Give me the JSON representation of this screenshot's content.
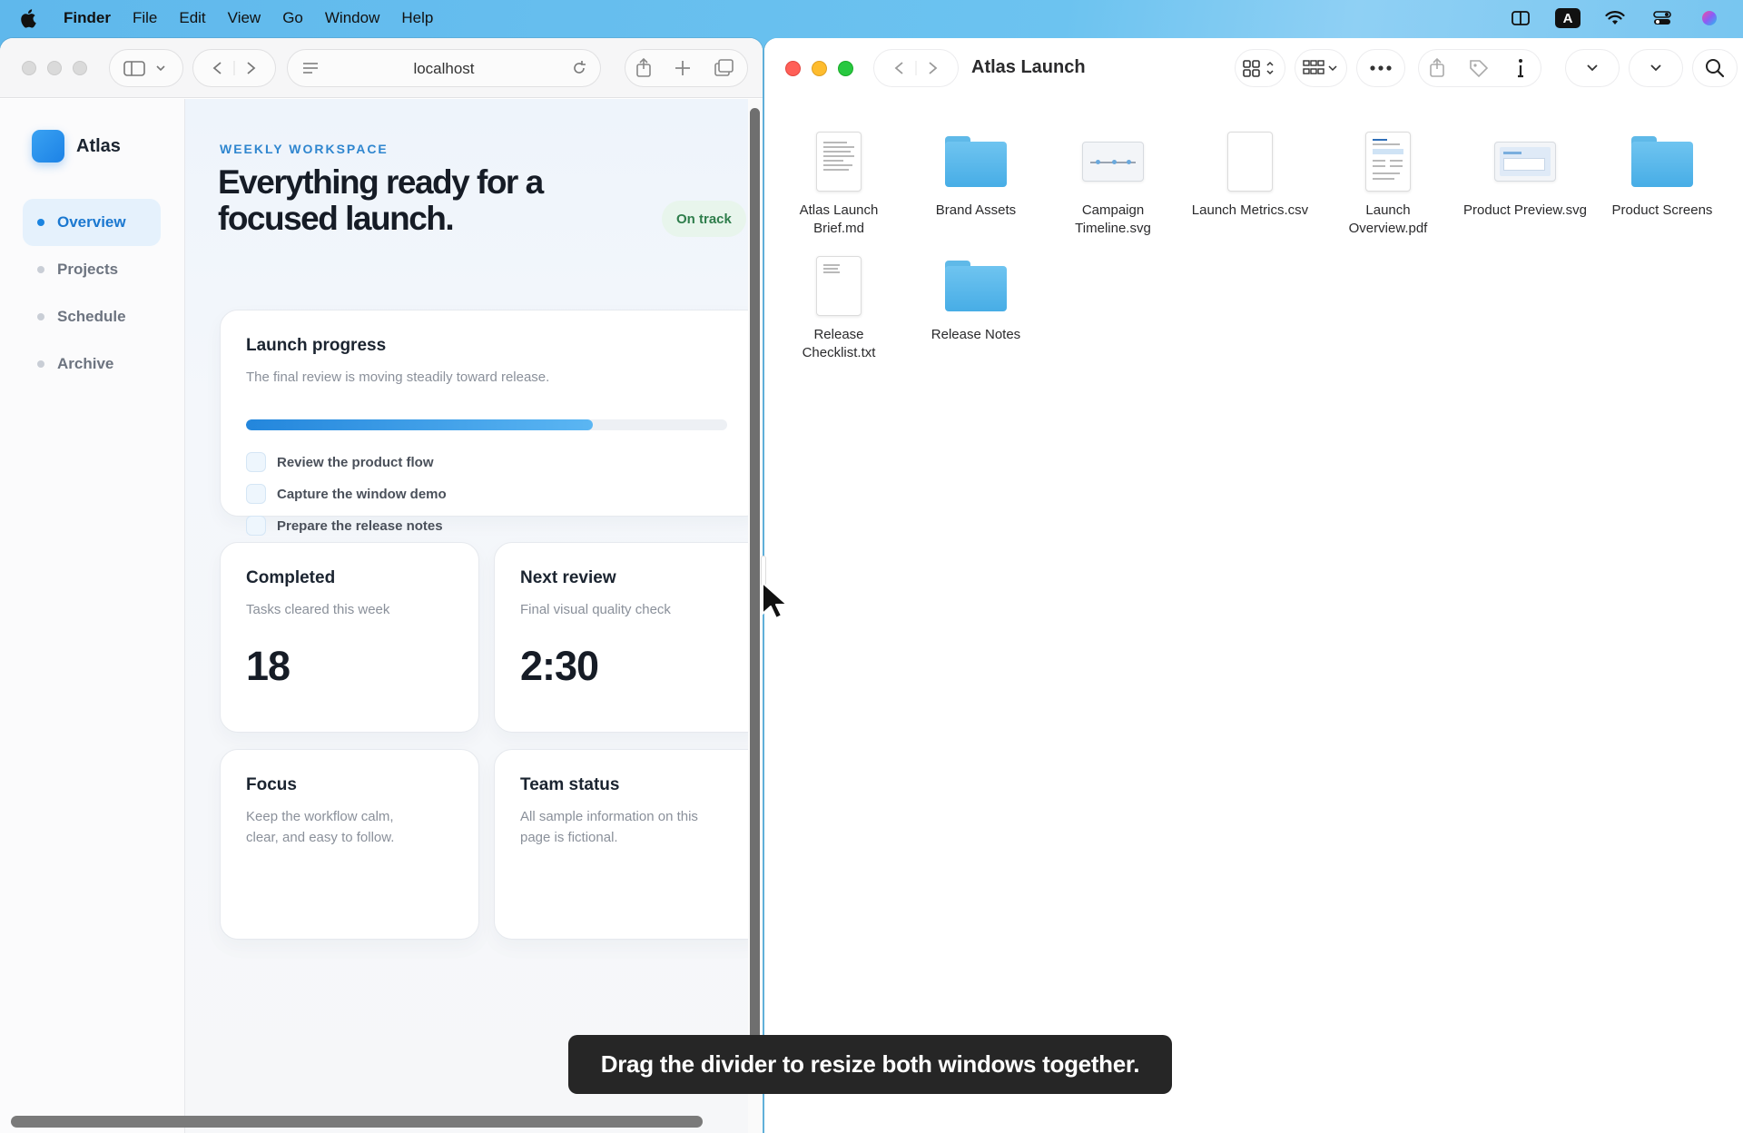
{
  "menubar": {
    "app": "Finder",
    "items": [
      "File",
      "Edit",
      "View",
      "Go",
      "Window",
      "Help"
    ],
    "input_badge": "A"
  },
  "browser": {
    "url": "localhost",
    "brand": "Atlas",
    "nav": [
      "Overview",
      "Projects",
      "Schedule",
      "Archive"
    ],
    "eyebrow": "WEEKLY WORKSPACE",
    "headline": "Everything ready for a focused launch.",
    "status_badge": "On track",
    "progress_card": {
      "title": "Launch progress",
      "subtitle": "The final review is moving steadily toward release.",
      "progress_fraction": 0.72,
      "tasks": [
        "Review the product flow",
        "Capture the window demo",
        "Prepare the release notes"
      ]
    },
    "completed_card": {
      "title": "Completed",
      "subtitle": "Tasks cleared this week",
      "value": "18"
    },
    "review_card": {
      "title": "Next review",
      "subtitle": "Final visual quality check",
      "value": "2:30"
    },
    "focus_card": {
      "title": "Focus",
      "subtitle": "Keep the workflow calm, clear, and easy to follow."
    },
    "team_card": {
      "title": "Team status",
      "subtitle": "All sample information on this page is fictional."
    }
  },
  "finder": {
    "title": "Atlas Launch",
    "items": [
      {
        "name": "Atlas Launch Brief.md",
        "kind": "doc"
      },
      {
        "name": "Brand Assets",
        "kind": "folder"
      },
      {
        "name": "Campaign Timeline.svg",
        "kind": "svg"
      },
      {
        "name": "Launch Metrics.csv",
        "kind": "blank"
      },
      {
        "name": "Launch Overview.pdf",
        "kind": "pdf"
      },
      {
        "name": "Product Preview.svg",
        "kind": "preview"
      },
      {
        "name": "Product Screens",
        "kind": "folder"
      },
      {
        "name": "Release Checklist.txt",
        "kind": "doc"
      },
      {
        "name": "Release Notes",
        "kind": "folder"
      }
    ]
  },
  "toast": "Drag the divider to resize both windows together."
}
